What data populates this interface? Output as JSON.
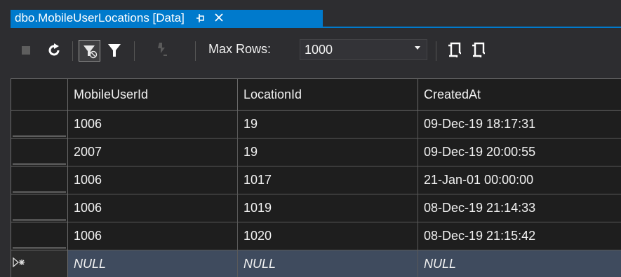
{
  "tab": {
    "title": "dbo.MobileUserLocations [Data]",
    "pin_icon": "pin-icon",
    "close_icon": "close-icon",
    "accent": "#007acc"
  },
  "toolbar": {
    "stop_icon": "stop-icon",
    "refresh_icon": "refresh-icon",
    "filter_clear_icon": "filter-clear-icon",
    "filter_icon": "filter-icon",
    "script_icon": "script-icon",
    "max_rows_label": "Max Rows:",
    "max_rows_value": "1000",
    "script_insert_icon": "script-insert-icon",
    "script_select_icon": "script-select-icon"
  },
  "grid": {
    "columns": [
      "MobileUserId",
      "LocationId",
      "CreatedAt"
    ],
    "rows": [
      [
        "1006",
        "19",
        "09-Dec-19 18:17:31"
      ],
      [
        "2007",
        "19",
        "09-Dec-19 20:00:55"
      ],
      [
        "1006",
        "1017",
        "21-Jan-01 00:00:00"
      ],
      [
        "1006",
        "1019",
        "08-Dec-19 21:14:33"
      ],
      [
        "1006",
        "1020",
        "08-Dec-19 21:15:42"
      ]
    ],
    "new_row": [
      "NULL",
      "NULL",
      "NULL"
    ],
    "new_row_icon": "new-row-icon",
    "selection_color": "#3f4b5e"
  }
}
